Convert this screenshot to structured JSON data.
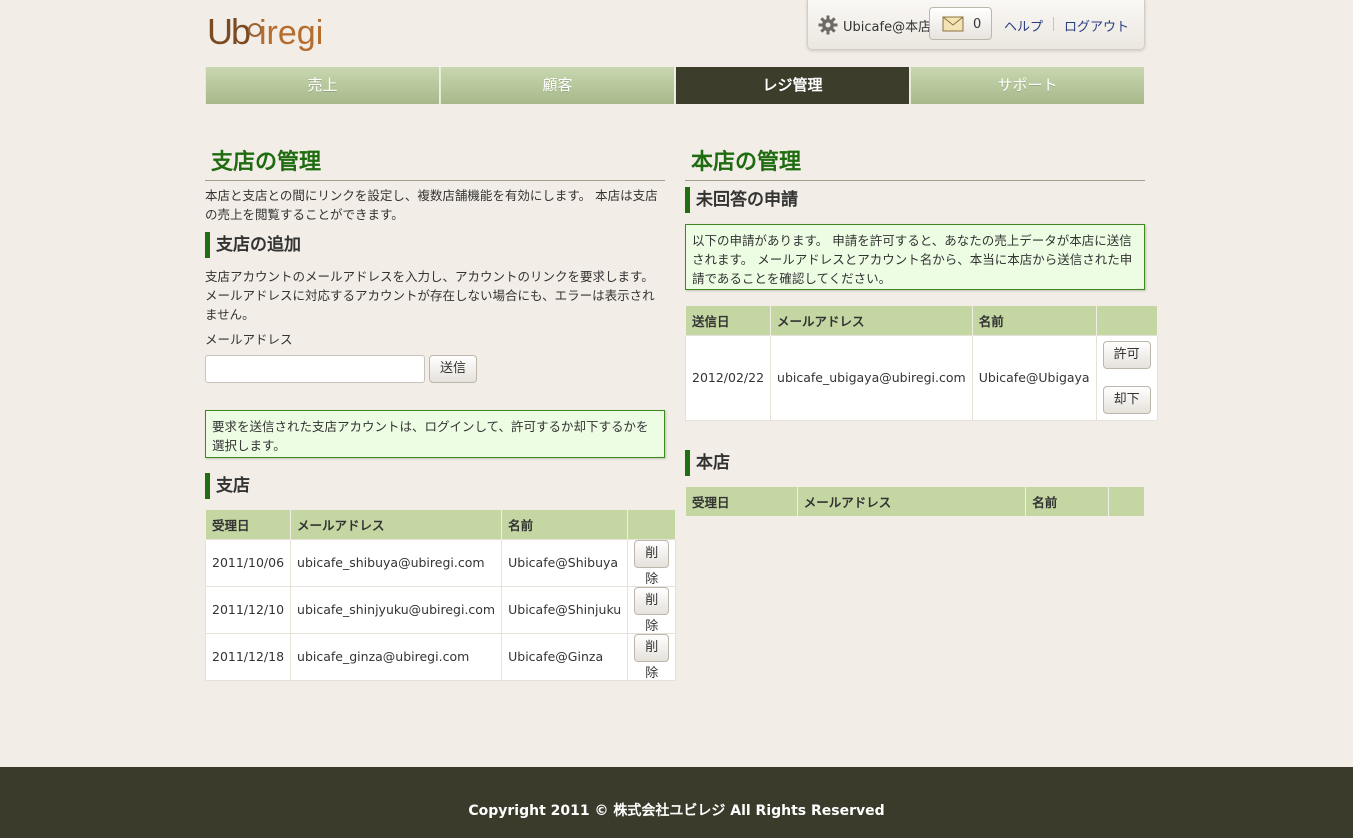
{
  "header": {
    "logo_text": "Ubiregi",
    "account_name": "Ubicafe@本店",
    "message_count": "0",
    "help_label": "ヘルプ",
    "logout_label": "ログアウト"
  },
  "nav": {
    "tabs": [
      {
        "label": "売上",
        "active": false
      },
      {
        "label": "顧客",
        "active": false
      },
      {
        "label": "レジ管理",
        "active": true
      },
      {
        "label": "サポート",
        "active": false
      }
    ]
  },
  "branch": {
    "title": "支店の管理",
    "description": "本店と支店との間にリンクを設定し、複数店舗機能を有効にします。 本店は支店の売上を閲覧することができます。",
    "add_title": "支店の追加",
    "add_description": "支店アカウントのメールアドレスを入力し、アカウントのリンクを要求します。 メールアドレスに対応するアカウントが存在しない場合にも、エラーは表示されません。",
    "email_label": "メールアドレス",
    "email_value": "",
    "email_placeholder": "",
    "send_label": "送信",
    "notice": "要求を送信された支店アカウントは、ログインして、許可するか却下するかを選択します。",
    "list_title": "支店",
    "columns": [
      "受理日",
      "メールアドレス",
      "名前",
      ""
    ],
    "rows": [
      {
        "date": "2011/10/06",
        "email": "ubicafe_shibuya@ubiregi.com",
        "name": "Ubicafe@Shibuya",
        "action": "削除"
      },
      {
        "date": "2011/12/10",
        "email": "ubicafe_shinjyuku@ubiregi.com",
        "name": "Ubicafe@Shinjuku",
        "action": "削除"
      },
      {
        "date": "2011/12/18",
        "email": "ubicafe_ginza@ubiregi.com",
        "name": "Ubicafe@Ginza",
        "action": "削除"
      }
    ]
  },
  "head_office": {
    "title": "本店の管理",
    "pending_title": "未回答の申請",
    "pending_notice": "以下の申請があります。 申請を許可すると、あなたの売上データが本店に送信されます。 メールアドレスとアカウント名から、本当に本店から送信された申請であることを確認してください。",
    "pending_columns": [
      "送信日",
      "メールアドレス",
      "名前",
      ""
    ],
    "pending_rows": [
      {
        "date": "2012/02/22",
        "email": "ubicafe_ubigaya@ubiregi.com",
        "name": "Ubicafe@Ubigaya",
        "accept": "許可",
        "reject": "却下"
      }
    ],
    "head_title": "本店",
    "head_columns": [
      "受理日",
      "メールアドレス",
      "名前",
      ""
    ]
  },
  "footer": {
    "copyright": "Copyright 2011 © 株式会社ユビレジ All Rights Reserved"
  },
  "colors": {
    "accent_green": "#1e6b10",
    "nav_active": "#3c3d2a",
    "table_header": "#c4d7a3",
    "footer_bg": "#3a3b2b"
  }
}
